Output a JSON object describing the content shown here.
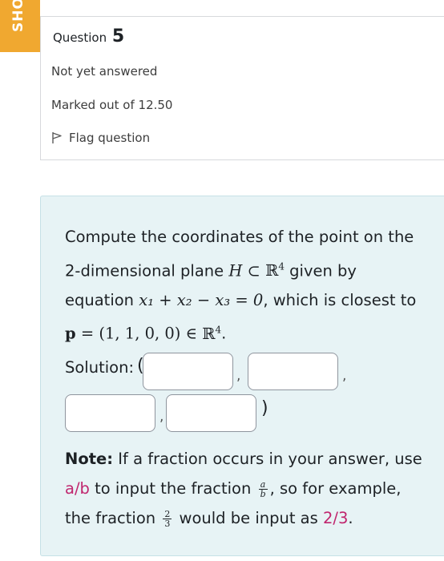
{
  "tab_label": "SHO",
  "question": {
    "title_prefix": "Question",
    "number": "5",
    "state": "Not yet answered",
    "marked_out_of": "Marked out of 12.50",
    "flag_label": "Flag question"
  },
  "content": {
    "text_part1": "Compute the coordinates of the point on the 2-dimensional plane",
    "plane_symbol": "H",
    "subset_symbol": "⊂",
    "space_symbol": "ℝ",
    "space_exponent": "4",
    "text_part2": "given by equation",
    "equation": "x₁ + x₂ − x₃ = 0",
    "text_part3": ", which is closest to",
    "point_symbol": "p",
    "point_value": "= (1, 1, 0, 0) ∈",
    "period": "."
  },
  "solution": {
    "label": "Solution:",
    "open_paren": "(",
    "close_paren": ")",
    "separator": ",",
    "inputs": [
      "",
      "",
      "",
      ""
    ]
  },
  "note": {
    "bold_label": "Note:",
    "text1": "If a fraction occurs in your answer, use",
    "code1": "a/b",
    "text2": "to input the fraction",
    "frac1_num": "a",
    "frac1_den": "b",
    "text3": ", so for example, the fraction",
    "frac2_num": "2",
    "frac2_den": "3",
    "text4": "would be input as",
    "code2": "2/3",
    "text5": "."
  }
}
